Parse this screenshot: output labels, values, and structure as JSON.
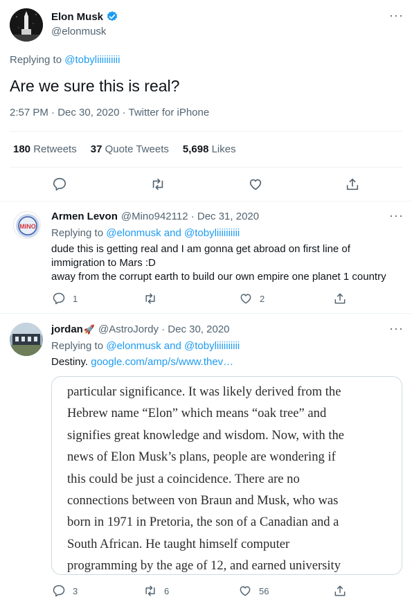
{
  "main_tweet": {
    "author_name": "Elon Musk",
    "handle": "@elonmusk",
    "replying_prefix": "Replying to ",
    "replying_to": "@tobyliiiiiiiiii",
    "text": "Are we sure this is real?",
    "meta": "2:57 PM · Dec 30, 2020 · Twitter for iPhone",
    "stats": [
      {
        "count": "180",
        "label": " Retweets"
      },
      {
        "count": "37",
        "label": " Quote Tweets"
      },
      {
        "count": "5,698",
        "label": " Likes"
      }
    ]
  },
  "replies": [
    {
      "author_name": "Armen Levon",
      "handle_date": "@Mino942112 · Dec 31, 2020",
      "replying_prefix": "Replying to ",
      "replying_to": "@elonmusk and @tobyliiiiiiiiii",
      "text_line1": "dude this is getting real and I am gonna get abroad on first line of",
      "text_line2": "immigration to Mars :D",
      "text_line3": "away from the corrupt earth to build our own empire one planet 1 country",
      "reply_count": "1",
      "retweet_count": "",
      "like_count": "2",
      "avatar_text": "MINO"
    },
    {
      "author_name": "jordan",
      "emoji": "🚀",
      "handle_date": "@AstroJordy · Dec 30, 2020",
      "replying_prefix": "Replying to ",
      "replying_to": "@elonmusk and @tobyliiiiiiiiii",
      "text": "Destiny. ",
      "link": "google.com/amp/s/www.thev…",
      "article_text": "particular significance. It was likely derived from the\nHebrew name “Elon” which means “oak tree” and\nsignifies great knowledge and wisdom. Now, with the\nnews of Elon Musk’s plans, people are wondering if\nthis could be just a coincidence. There are no\nconnections between von Braun and Musk, who was\nborn in 1971 in Pretoria, the son of a Canadian and a\nSouth African. He taught himself computer\nprogramming by the age of 12, and earned university",
      "reply_count": "3",
      "retweet_count": "6",
      "like_count": "56"
    }
  ],
  "more_label": "···",
  "colors": {
    "accent": "#1d9bf0",
    "verified": "#1d9bf0",
    "muted": "#536471",
    "divider": "#eff3f4"
  }
}
